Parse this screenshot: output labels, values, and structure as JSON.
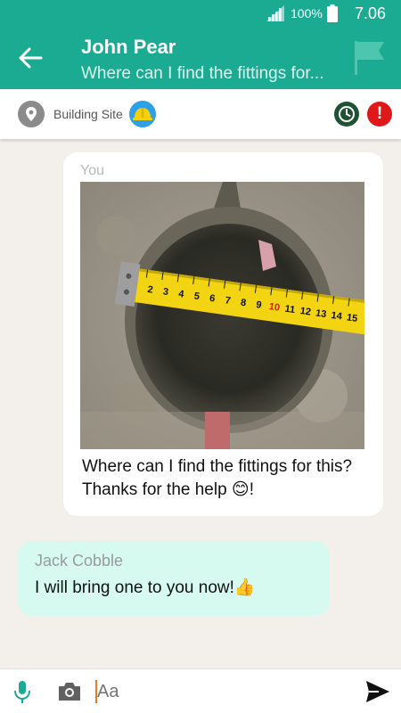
{
  "status_bar": {
    "battery_percent": "100%",
    "time": "7.06"
  },
  "header": {
    "title": "John Pear",
    "subtitle": "Where can I find the fittings for...",
    "back_icon": "arrow-left-icon",
    "flag_icon": "flag-icon"
  },
  "site_bar": {
    "location_label": "Building Site",
    "location_icon": "map-pin-icon",
    "helmet_icon": "hard-hat-icon",
    "clock_icon": "clock-icon",
    "alert_icon": "alert-icon",
    "alert_glyph": "!"
  },
  "messages": [
    {
      "sender": "You",
      "direction": "outgoing",
      "image": "photo of pipe hole with measuring tape",
      "text": "Where can I find the fittings for this? Thanks for the help 😊!"
    },
    {
      "sender": "Jack Cobble",
      "direction": "incoming",
      "text": "I will bring one to you now!👍"
    }
  ],
  "composer": {
    "placeholder": "Aa",
    "mic_icon": "microphone-icon",
    "camera_icon": "camera-icon",
    "send_icon": "send-icon"
  },
  "colors": {
    "brand": "#1aab92",
    "incoming_bubble": "#d6faf0",
    "background": "#f3f0eb",
    "alert": "#e01818",
    "clock": "#1e5233"
  },
  "tape_marks": [
    "2",
    "3",
    "4",
    "5",
    "6",
    "7",
    "8",
    "9",
    "10",
    "11",
    "12",
    "13",
    "14",
    "15"
  ]
}
